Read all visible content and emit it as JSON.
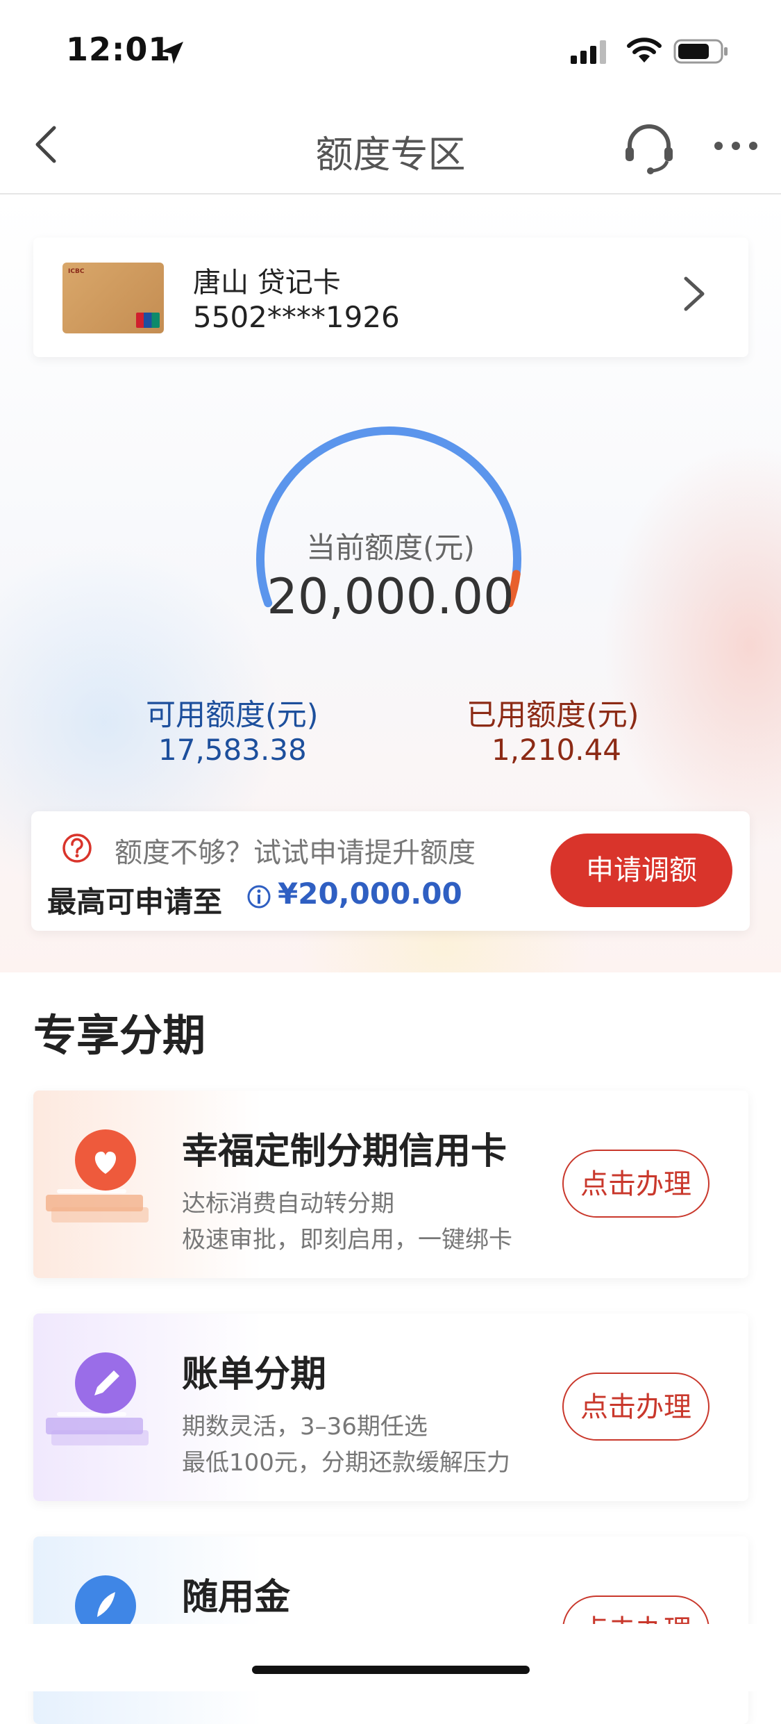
{
  "status": {
    "time": "12:01"
  },
  "nav": {
    "title": "额度专区"
  },
  "card": {
    "name": "唐山 贷记卡",
    "number": "5502****1926"
  },
  "gauge": {
    "label": "当前额度(元)",
    "value": "20,000.00",
    "available_label": "可用额度(元)",
    "available_value": "17,583.38",
    "used_label": "已用额度(元)",
    "used_value": "1,210.44",
    "used_fraction": 0.0605,
    "colors": {
      "available": "#5b95ec",
      "used": "#e8602d"
    }
  },
  "increase": {
    "hint": "额度不够？试试申请提升额度",
    "max_label": "最高可申请至",
    "max_value": "¥20,000.00",
    "button": "申请调额"
  },
  "section": {
    "title": "专享分期"
  },
  "products": [
    {
      "title": "幸福定制分期信用卡",
      "desc1": "达标消费自动转分期",
      "desc2": "极速审批，即刻启用，一键绑卡",
      "button": "点击办理",
      "icon": "heart-icon"
    },
    {
      "title": "账单分期",
      "desc1": "期数灵活，3–36期任选",
      "desc2": "最低100元，分期还款缓解压力",
      "button": "点击办理",
      "icon": "pencil-icon"
    },
    {
      "title": "随用金",
      "desc1": "",
      "desc2": "",
      "button": "点击办理",
      "icon": "rocket-icon"
    }
  ]
}
